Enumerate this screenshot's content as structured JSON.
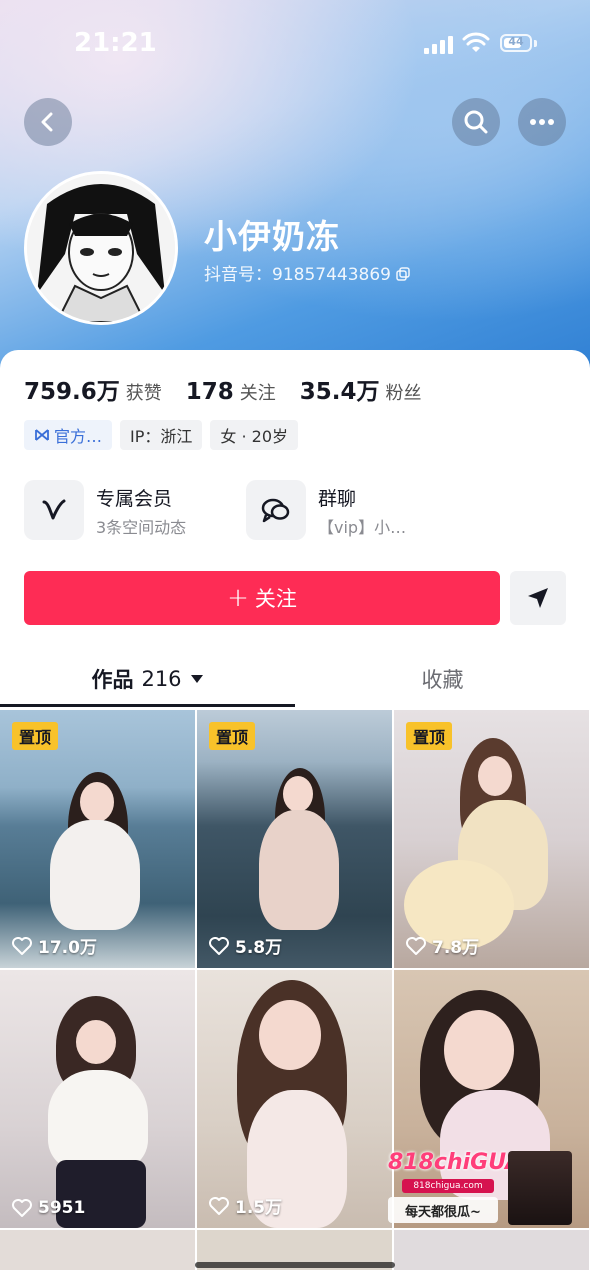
{
  "status_bar": {
    "time": "21:21",
    "battery": "44"
  },
  "profile": {
    "nickname": "小伊奶冻",
    "douyin_id": "抖音号：91857443869"
  },
  "stats": [
    {
      "value": "759.6万",
      "label": "获赞"
    },
    {
      "value": "178",
      "label": "关注"
    },
    {
      "value": "35.4万",
      "label": "粉丝"
    }
  ],
  "tags": {
    "official": "官方…",
    "ip": "IP：浙江",
    "gender_age": "女 · 20岁"
  },
  "features": [
    {
      "title": "专属会员",
      "subtitle": "3条空间动态",
      "icon": "vip-v-icon"
    },
    {
      "title": "群聊",
      "subtitle": "【vip】小…",
      "icon": "group-chat-icon"
    }
  ],
  "actions": {
    "follow_label": "关注",
    "follow_prefix": "+"
  },
  "tabs": {
    "works_label": "作品",
    "works_count": "216",
    "favorites_label": "收藏"
  },
  "grid": {
    "pinned_label": "置顶",
    "items": [
      {
        "likes": "17.0万",
        "pinned": true
      },
      {
        "likes": "5.8万",
        "pinned": true
      },
      {
        "likes": "7.8万",
        "pinned": true
      },
      {
        "likes": "5951",
        "pinned": false
      },
      {
        "likes": "1.5万",
        "pinned": false
      },
      {
        "likes": "",
        "pinned": false
      }
    ],
    "promo": {
      "brand": "818chiGUA",
      "url": "818chigua.com",
      "slogan": "每天都很瓜~"
    }
  },
  "colors": {
    "follow": "#fe2c55",
    "pin": "#f8c22a",
    "header_blue": "#4f9be2"
  }
}
